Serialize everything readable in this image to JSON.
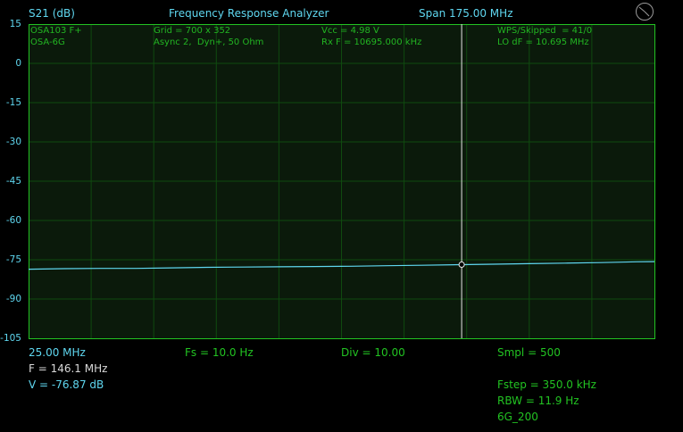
{
  "header": {
    "measurement": "S21 (dB)",
    "title": "Frequency Response Analyzer",
    "span": "Span 175.00 MHz"
  },
  "info": {
    "device": "OSA103 F+",
    "module": "OSA-6G",
    "grid": "Grid = 700 x 352",
    "mode": "Async 2,  Dyn+, 50 Ohm",
    "vcc": "Vcc = 4.98 V",
    "rxf": "Rx F = 10695.000 kHz",
    "wps": "WPS/Skipped  = 41/0",
    "lodf": "LO dF = 10.695 MHz"
  },
  "y_axis": {
    "ticks": [
      "15",
      "0",
      "-15",
      "-30",
      "-45",
      "-60",
      "-75",
      "-90",
      "-105"
    ]
  },
  "footer": {
    "start_freq": "25.00 MHz",
    "fs": "Fs = 10.0 Hz",
    "div": "Div = 10.00",
    "smpl": "Smpl = 500",
    "marker_f": "F = 146.1 MHz",
    "marker_v": "V = -76.87 dB",
    "fstep": "Fstep = 350.0 kHz",
    "rbw": "RBW = 11.9 Hz",
    "band": "6G_200"
  },
  "chart_data": {
    "type": "line",
    "x_unit": "MHz",
    "y_unit": "dB",
    "xlim": [
      25.0,
      200.0
    ],
    "ylim": [
      -105,
      15
    ],
    "grid": true,
    "series": [
      {
        "color": "#5fd7f0",
        "x": [
          25,
          35,
          45,
          55,
          65,
          75,
          85,
          95,
          105,
          115,
          125,
          135,
          146.1,
          155,
          165,
          175,
          185,
          195,
          200
        ],
        "y": [
          -78.6,
          -78.4,
          -78.3,
          -78.3,
          -78.1,
          -77.9,
          -77.8,
          -77.7,
          -77.6,
          -77.5,
          -77.3,
          -77.1,
          -76.87,
          -76.7,
          -76.5,
          -76.3,
          -76.1,
          -75.8,
          -75.7
        ]
      }
    ],
    "marker": {
      "x": 146.1,
      "y": -76.87
    }
  },
  "colors": {
    "background": "#000000",
    "frame": "#22c322",
    "grid": "#0f4a0f",
    "trace": "#5fd7f0",
    "marker_line": "#e8e8e8"
  }
}
